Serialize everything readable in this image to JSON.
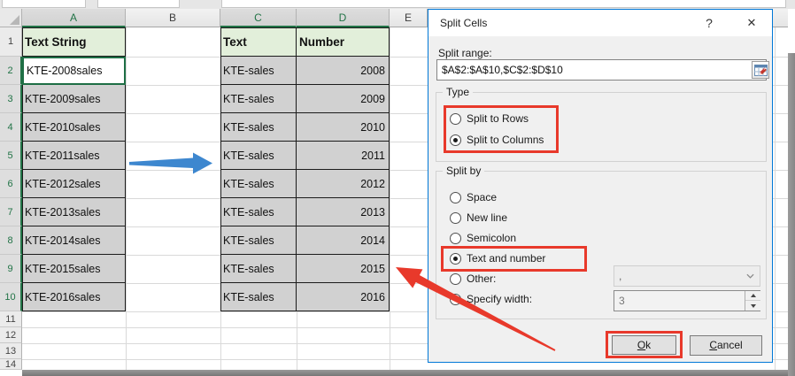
{
  "colors": {
    "accent": "#0078D7",
    "annotation_red": "#e8392b",
    "arrow_blue": "#3d87cf",
    "header_green": "#217346",
    "cell_green_fill": "#e2efda",
    "selection_gray": "#d1d1d1"
  },
  "sheet": {
    "col_headers": [
      {
        "label": "A",
        "selected": true
      },
      {
        "label": "B",
        "selected": false
      },
      {
        "label": "C",
        "selected": true
      },
      {
        "label": "D",
        "selected": true
      },
      {
        "label": "E",
        "selected": false
      }
    ],
    "row_numbers": [
      "1",
      "2",
      "3",
      "4",
      "5",
      "6",
      "7",
      "8",
      "9",
      "10",
      "11",
      "12",
      "13",
      "14"
    ],
    "columnA": {
      "header": "Text String",
      "values": [
        "KTE-2008sales",
        "KTE-2009sales",
        "KTE-2010sales",
        "KTE-2011sales",
        "KTE-2012sales",
        "KTE-2013sales",
        "KTE-2014sales",
        "KTE-2015sales",
        "KTE-2016sales"
      ]
    },
    "columnC": {
      "header": "Text",
      "values": [
        "KTE-sales",
        "KTE-sales",
        "KTE-sales",
        "KTE-sales",
        "KTE-sales",
        "KTE-sales",
        "KTE-sales",
        "KTE-sales",
        "KTE-sales"
      ]
    },
    "columnD": {
      "header": "Number",
      "values": [
        "2008",
        "2009",
        "2010",
        "2011",
        "2012",
        "2013",
        "2014",
        "2015",
        "2016"
      ]
    }
  },
  "dialog": {
    "title": "Split Cells",
    "help_glyph": "?",
    "close_glyph": "✕",
    "range_label": "Split range:",
    "range_value": "$A$2:$A$10,$C$2:$D$10",
    "type_group": {
      "label": "Type",
      "options": [
        {
          "label": "Split to Rows",
          "checked": false
        },
        {
          "label": "Split to Columns",
          "checked": true
        }
      ]
    },
    "split_by_group": {
      "label": "Split by",
      "options": [
        {
          "label": "Space",
          "checked": false
        },
        {
          "label": "New line",
          "checked": false
        },
        {
          "label": "Semicolon",
          "checked": false
        },
        {
          "label": "Text and number",
          "checked": true
        },
        {
          "label": "Other:",
          "checked": false
        },
        {
          "label": "Specify width:",
          "checked": false
        }
      ]
    },
    "other_value": ",",
    "width_value": "3",
    "ok_label": "Ok",
    "cancel_label": "Cancel"
  }
}
